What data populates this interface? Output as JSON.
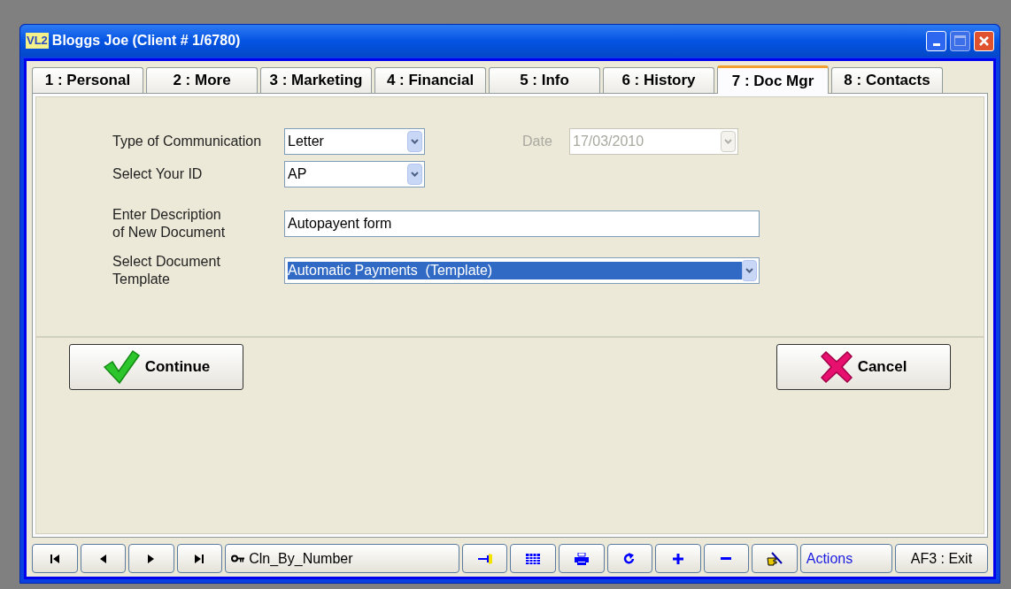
{
  "window": {
    "logo": "VL2",
    "title": "Bloggs Joe (Client # 1/6780)"
  },
  "tabs": [
    {
      "label": "1 : Personal",
      "selected": false
    },
    {
      "label": "2 : More",
      "selected": false
    },
    {
      "label": "3 : Marketing",
      "selected": false
    },
    {
      "label": "4 : Financial",
      "selected": false
    },
    {
      "label": "5 : Info",
      "selected": false
    },
    {
      "label": "6 : History",
      "selected": false
    },
    {
      "label": "7 : Doc Mgr",
      "selected": true
    },
    {
      "label": "8 : Contacts",
      "selected": false
    }
  ],
  "form": {
    "communication": {
      "label": "Type of Communication",
      "value": "Letter"
    },
    "date": {
      "label": "Date",
      "value": "17/03/2010",
      "disabled": true
    },
    "your_id": {
      "label": "Select Your ID",
      "value": "AP"
    },
    "description": {
      "label": "Enter Description\nof New Document",
      "value": "Autopayent form"
    },
    "template": {
      "label": "Select Document\nTemplate",
      "value": "Automatic Payments  (Template)",
      "highlighted": true
    }
  },
  "buttons": [
    {
      "kind": "continue",
      "label": "Continue"
    },
    {
      "kind": "cancel",
      "label": "Cancel"
    }
  ],
  "toolbar": [
    {
      "kind": "first"
    },
    {
      "kind": "prev"
    },
    {
      "kind": "next"
    },
    {
      "kind": "last"
    },
    {
      "kind": "key",
      "label": "Cln_By_Number"
    },
    {
      "kind": "pin"
    },
    {
      "kind": "grid"
    },
    {
      "kind": "print"
    },
    {
      "kind": "redo"
    },
    {
      "kind": "add"
    },
    {
      "kind": "remove"
    },
    {
      "kind": "hand"
    },
    {
      "kind": "actions",
      "label": "Actions"
    },
    {
      "kind": "exit",
      "label": "AF3 : Exit"
    }
  ]
}
